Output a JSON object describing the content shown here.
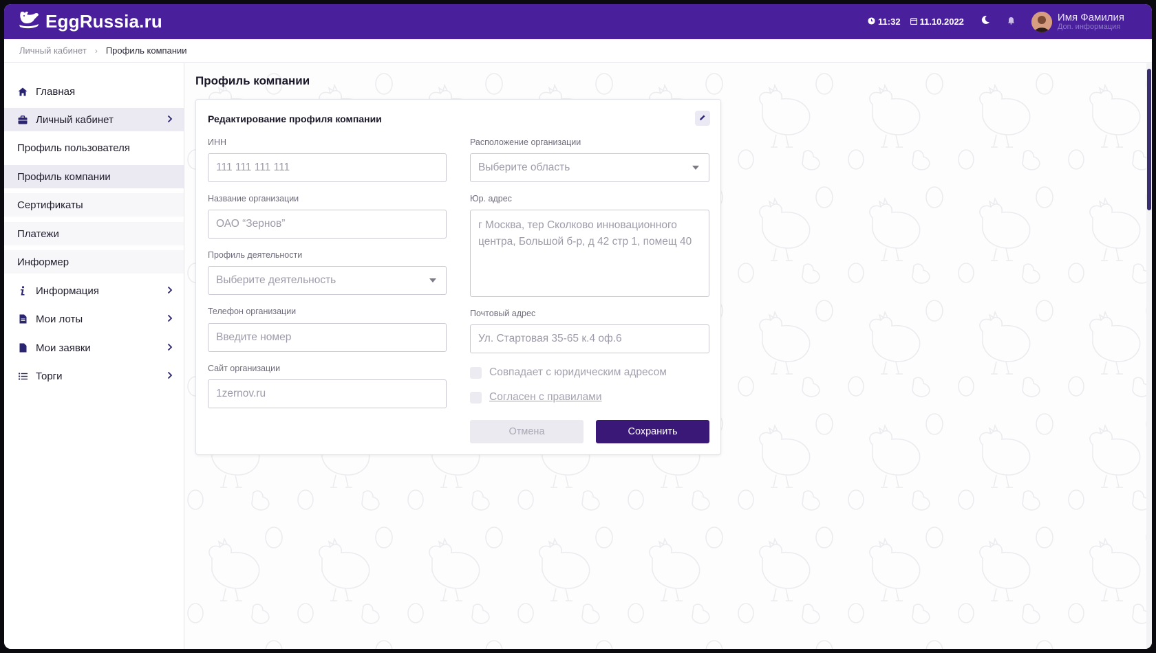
{
  "app": {
    "name": "EggRussia.ru"
  },
  "header": {
    "time": "11:32",
    "date": "11.10.2022",
    "user_name": "Имя Фамилия",
    "user_sub": "Доп. информация"
  },
  "breadcrumb": {
    "parent": "Личный кабинет",
    "current": "Профиль компании"
  },
  "sidebar": {
    "items": [
      {
        "label": "Главная",
        "icon": "home-icon"
      },
      {
        "label": "Личный кабинет",
        "icon": "briefcase-icon"
      },
      {
        "label": "Профиль пользователя"
      },
      {
        "label": "Профиль компании"
      },
      {
        "label": "Сертификаты"
      },
      {
        "label": "Платежи"
      },
      {
        "label": "Информер"
      },
      {
        "label": "Информация",
        "icon": "info-icon"
      },
      {
        "label": "Мои лоты",
        "icon": "document-icon"
      },
      {
        "label": "Мои заявки",
        "icon": "document-icon"
      },
      {
        "label": "Торги",
        "icon": "list-icon"
      }
    ]
  },
  "main": {
    "title": "Профиль компании",
    "card": {
      "title": "Редактирование профиля компании",
      "inn": {
        "label": "ИНН",
        "placeholder": "111 111 111 111"
      },
      "org_name": {
        "label": "Название организации",
        "placeholder": "ОАО “Зернов”"
      },
      "activity": {
        "label": "Профиль деятельности",
        "placeholder": "Выберите деятельность"
      },
      "phone": {
        "label": "Телефон организации",
        "placeholder": "Введите номер"
      },
      "site": {
        "label": "Сайт организации",
        "placeholder": "1zernov.ru"
      },
      "location": {
        "label": "Расположение организации",
        "placeholder": "Выберите область"
      },
      "legal_address": {
        "label": "Юр. адрес",
        "placeholder": "г Москва, тер Сколково инновационного центра, Большой б-р, д 42 стр 1, помещ 40"
      },
      "postal_address": {
        "label": "Почтовый адрес",
        "placeholder": "Ул. Стартовая 35-65 к.4 оф.6"
      },
      "same_address_label": "Совпадает с юридическим адресом",
      "agree_label": "Согласен с правилами",
      "cancel_label": "Отмена",
      "save_label": "Сохранить"
    }
  },
  "colors": {
    "brand": "#4a1f9c",
    "primary_button": "#3a1878"
  }
}
